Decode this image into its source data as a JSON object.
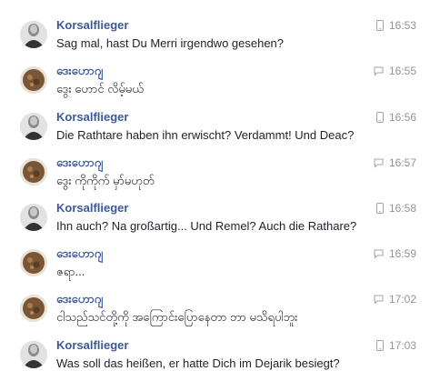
{
  "messages": [
    {
      "sender": "Korsalflieger",
      "text": "Sag mal, hast Du Merri irgendwo gesehen?",
      "time": "16:53",
      "device": "mobile-icon",
      "avatar": "sender-a"
    },
    {
      "sender": "ဒေးဟောဂျ",
      "text": "ဒွေး ဟောင် လိမ့်မယ်",
      "time": "16:55",
      "device": "chat-bubble-icon",
      "avatar": "sender-b"
    },
    {
      "sender": "Korsalflieger",
      "text": "Die Rathtare haben ihn erwischt? Verdammt! Und Deac?",
      "time": "16:56",
      "device": "mobile-icon",
      "avatar": "sender-a"
    },
    {
      "sender": "ဒေးဟောဂျ",
      "text": "ဒွေး ကိုကိုက် မှာ်မဟုတ်",
      "time": "16:57",
      "device": "chat-bubble-icon",
      "avatar": "sender-b"
    },
    {
      "sender": "Korsalflieger",
      "text": "Ihn auch? Na großartig... Und Remel? Auch die Rathare?",
      "time": "16:58",
      "device": "mobile-icon",
      "avatar": "sender-a"
    },
    {
      "sender": "ဒေးဟောဂျ",
      "text": "ဇရာ...",
      "time": "16:59",
      "device": "chat-bubble-icon",
      "avatar": "sender-b"
    },
    {
      "sender": "ဒေးဟောဂျ",
      "text": "ငါသည်သင်တို့ကို အကြောင်းပြောနေတာ ဘာ မသိရပါဘူး",
      "time": "17:02",
      "device": "chat-bubble-icon",
      "avatar": "sender-b"
    },
    {
      "sender": "Korsalflieger",
      "text": "Was soll das heißen, er hatte Dich im Dejarik besiegt?",
      "time": "17:03",
      "device": "mobile-icon",
      "avatar": "sender-a"
    }
  ],
  "colors": {
    "sender_name": "#3b5998",
    "message_text": "#1d2129",
    "timestamp": "#90949c"
  }
}
